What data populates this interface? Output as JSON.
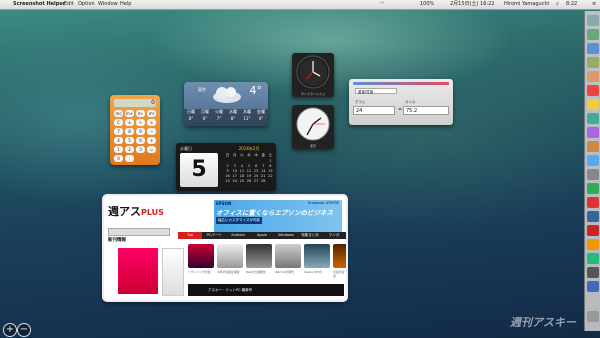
{
  "menubar": {
    "app_name": "Screenshot Helper",
    "menus": [
      "Edit",
      "Option",
      "Window",
      "Help"
    ],
    "datetime": "2月15日(土) 16:22",
    "user": "Hiromi Yamaguchi",
    "battery": "100%",
    "right_time": "8:22",
    "apple_glyph": ""
  },
  "calculator": {
    "display": "0",
    "keys": [
      "mc",
      "m+",
      "m-",
      "mr",
      "C",
      "±",
      "÷",
      "×",
      "7",
      "8",
      "9",
      "−",
      "4",
      "5",
      "6",
      "+",
      "1",
      "2",
      "3",
      "=",
      "0",
      ".",
      "",
      ""
    ]
  },
  "weather": {
    "city": "東京",
    "temperature": "4°",
    "forecast": [
      {
        "day": "日曜",
        "temp": "8°"
      },
      {
        "day": "月曜",
        "temp": "6°"
      },
      {
        "day": "火曜",
        "temp": "7°"
      },
      {
        "day": "水曜",
        "temp": "8°"
      },
      {
        "day": "木曜",
        "temp": "11°"
      },
      {
        "day": "金曜",
        "temp": "4°"
      }
    ]
  },
  "clocks": [
    {
      "caption": "サンフランシスコ"
    },
    {
      "caption": "東京"
    }
  ],
  "converter": {
    "category": "重量/質量",
    "from_label": "グラム",
    "to_label": "オンス",
    "from_value": "24",
    "to_value": "75.2",
    "eq": "="
  },
  "date_widget": {
    "weekday": "水曜日",
    "day": "5",
    "month_title": "2014年2月",
    "weekday_heads": [
      "日",
      "月",
      "火",
      "水",
      "木",
      "金",
      "土"
    ],
    "calendar_days": [
      "",
      "",
      "",
      "",
      "",
      "",
      "1",
      "2",
      "3",
      "4",
      "5",
      "6",
      "7",
      "8",
      "9",
      "10",
      "11",
      "12",
      "13",
      "14",
      "15",
      "16",
      "17",
      "18",
      "19",
      "20",
      "21",
      "22",
      "23",
      "24",
      "25",
      "26",
      "27",
      "28"
    ]
  },
  "web_clip": {
    "logo": "週アス",
    "logo_sub": "PLUS",
    "ad_brand": "EPSON",
    "ad_tagline": "オフィスに置くならエプソンのビジネス",
    "ad_model": "Endeavor AT993E",
    "ad_button": "幅広いカスタマイズが可能",
    "nav": [
      "Top",
      "PCパーツ",
      "Android",
      "Apple",
      "Windows",
      "特集まとめ",
      "マンガ"
    ],
    "news_heading": "新刊情報",
    "footer_text": "アスキー・ドットPC 最新号",
    "thumb_captions": [
      "ソフトバンクが新",
      "今年の注目は薄型",
      "Macの大容量化",
      "iPad Airの時代",
      "Xperia Z1Fの",
      "今週の注目"
    ]
  },
  "watermark": "週刊アスキー",
  "controls": {
    "add": "+",
    "remove": "−"
  },
  "colors": {
    "calculator": "#e0791d",
    "accent_red": "#d62020",
    "epson_blue": "#4aa7e8"
  }
}
